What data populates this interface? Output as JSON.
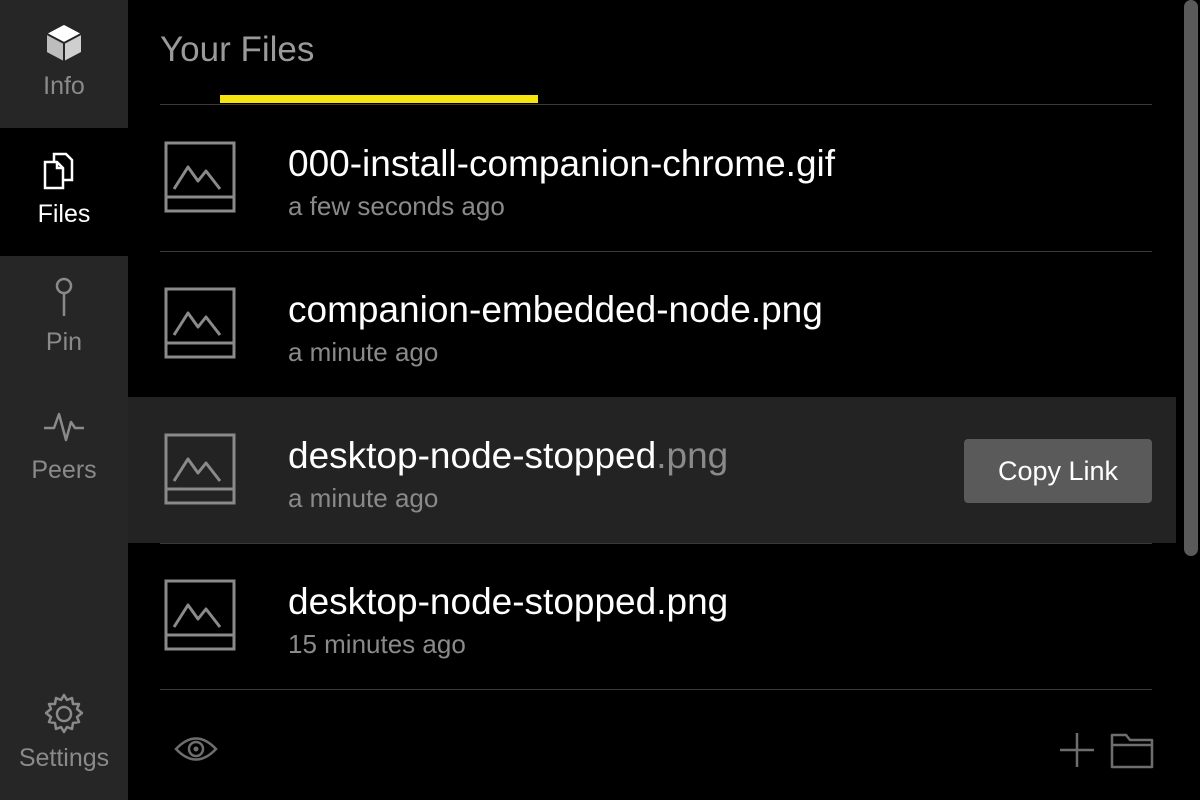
{
  "sidebar": {
    "items": [
      {
        "label": "Info",
        "icon": "cube-icon"
      },
      {
        "label": "Files",
        "icon": "files-icon"
      },
      {
        "label": "Pin",
        "icon": "pin-icon"
      },
      {
        "label": "Peers",
        "icon": "pulse-icon"
      },
      {
        "label": "Settings",
        "icon": "gear-icon"
      }
    ],
    "active": "Files"
  },
  "header": {
    "title": "Your Files"
  },
  "files": [
    {
      "name": "000-install-companion-chrome.gif",
      "time": "a few seconds ago"
    },
    {
      "name": "companion-embedded-node.png",
      "time": "a minute ago"
    },
    {
      "name_main": "desktop-node-stopped",
      "name_ext": ".png",
      "time": "a minute ago",
      "action_label": "Copy Link"
    },
    {
      "name": "desktop-node-stopped.png",
      "time": "15 minutes ago"
    }
  ],
  "footer": {
    "icons": [
      "eye-icon",
      "plus-icon",
      "folder-icon"
    ]
  },
  "colors": {
    "accent": "#f6e30f",
    "sidebar_bg": "#262626",
    "hover_row": "#232323",
    "button_bg": "#5a5a5a"
  }
}
